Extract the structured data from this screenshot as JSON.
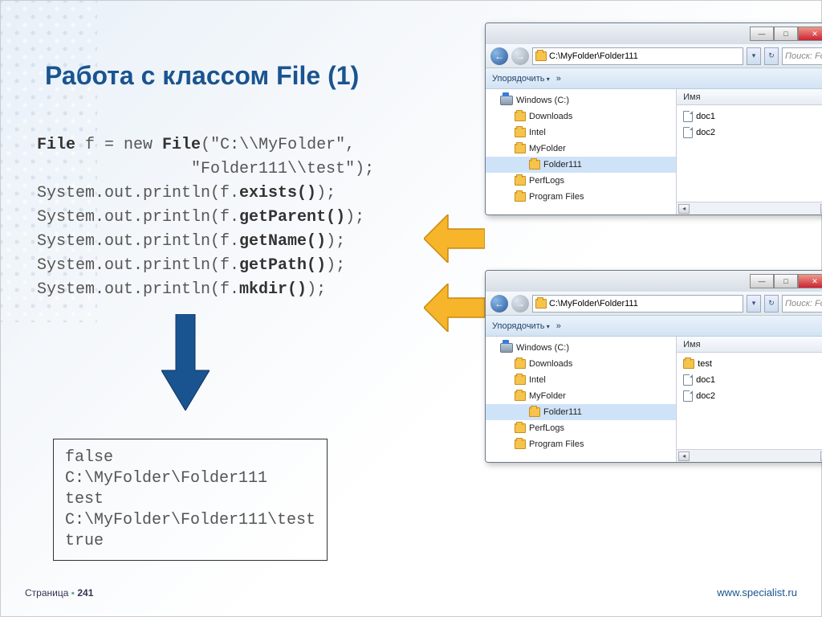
{
  "title": "Работа с классом File (1)",
  "code": {
    "l1a": "File",
    "l1b": " f = new ",
    "l1c": "File",
    "l1d": "(\"C:\\\\MyFolder\",",
    "l2": "                \"Folder111\\\\test\");",
    "l3a": "System.out.println(f.",
    "l3b": "exists()",
    "l3c": ");",
    "l4a": "System.out.println(f.",
    "l4b": "getParent()",
    "l4c": ");",
    "l5a": "System.out.println(f.",
    "l5b": "getName()",
    "l5c": ");",
    "l6a": "System.out.println(f.",
    "l6b": "getPath()",
    "l6c": ");",
    "l7a": "System.out.println(f.",
    "l7b": "mkdir()",
    "l7c": ");"
  },
  "output": "false\nC:\\MyFolder\\Folder111\ntest\nC:\\MyFolder\\Folder111\\test\ntrue",
  "footer": {
    "page_label": "Страница",
    "page_num": "241",
    "url": "www.specialist.ru"
  },
  "explorer": {
    "address": "C:\\MyFolder\\Folder111",
    "search": "Поиск: Fo",
    "organize": "Упорядочить",
    "more": "»",
    "col_name": "Имя",
    "tree": {
      "drive": "Windows (C:)",
      "items": [
        "Downloads",
        "Intel",
        "MyFolder",
        "Folder111",
        "PerfLogs",
        "Program Files"
      ]
    },
    "files_before": [
      "doc1",
      "doc2"
    ],
    "files_after": [
      "test",
      "doc1",
      "doc2"
    ]
  }
}
